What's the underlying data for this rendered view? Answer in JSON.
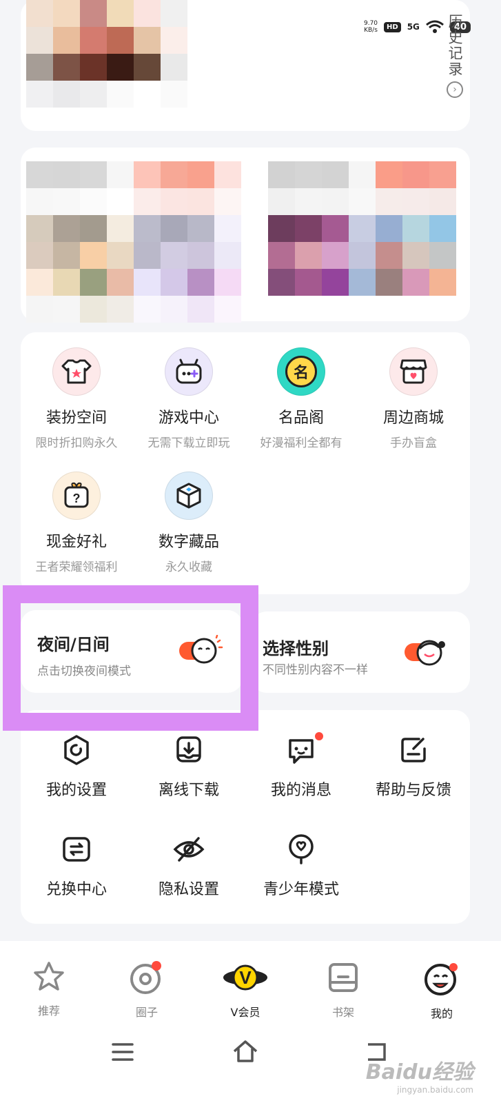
{
  "status_bar": {
    "speed_value": "9.70",
    "speed_unit": "KB/s",
    "hd_badge": "HD",
    "network": "5G",
    "battery": "40"
  },
  "history": {
    "label": "历史记录"
  },
  "features": [
    {
      "title": "装扮空间",
      "subtitle": "限时折扣购永久",
      "icon": "shirt-icon",
      "color": "#fde9ea"
    },
    {
      "title": "游戏中心",
      "subtitle": "无需下载立即玩",
      "icon": "gamepad-icon",
      "color": "#ece8fb"
    },
    {
      "title": "名品阁",
      "subtitle": "好漫福利全都有",
      "icon": "brand-icon",
      "color": "#cff5ef"
    },
    {
      "title": "周边商城",
      "subtitle": "手办盲盒",
      "icon": "store-icon",
      "color": "#fde9ea"
    },
    {
      "title": "现金好礼",
      "subtitle": "王者荣耀领福利",
      "icon": "gift-box-icon",
      "color": "#fdf0de"
    },
    {
      "title": "数字藏品",
      "subtitle": "永久收藏",
      "icon": "cube-icon",
      "color": "#dcedfa"
    }
  ],
  "toggles": {
    "night": {
      "title": "夜间/日间",
      "subtitle": "点击切换夜间模式"
    },
    "gender": {
      "title": "选择性别",
      "subtitle": "不同性别内容不一样"
    }
  },
  "tools": [
    {
      "label": "我的设置",
      "icon": "settings-icon"
    },
    {
      "label": "离线下载",
      "icon": "download-icon"
    },
    {
      "label": "我的消息",
      "icon": "message-icon"
    },
    {
      "label": "帮助与反馈",
      "icon": "feedback-icon"
    },
    {
      "label": "兑换中心",
      "icon": "exchange-icon"
    },
    {
      "label": "隐私设置",
      "icon": "privacy-icon"
    },
    {
      "label": "青少年模式",
      "icon": "youth-mode-icon"
    }
  ],
  "bottom_nav": [
    {
      "label": "推荐",
      "icon": "star-icon"
    },
    {
      "label": "圈子",
      "icon": "circle-icon"
    },
    {
      "label": "V会员",
      "icon": "vip-icon"
    },
    {
      "label": "书架",
      "icon": "bookshelf-icon"
    },
    {
      "label": "我的",
      "icon": "profile-icon"
    }
  ],
  "watermark": {
    "main": "Baidu经验",
    "sub": "jingyan.baidu.com"
  }
}
